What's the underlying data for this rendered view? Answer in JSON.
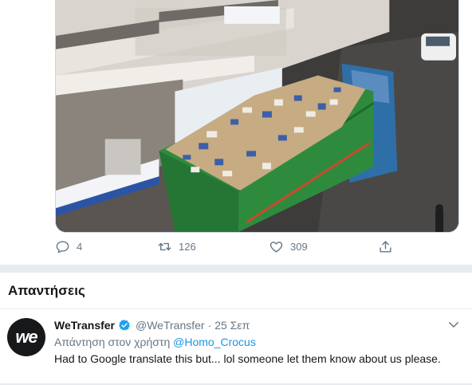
{
  "tweet": {
    "actions": {
      "reply_count": "4",
      "retweet_count": "126",
      "like_count": "309"
    }
  },
  "replies_section": {
    "heading": "Απαντήσεις"
  },
  "reply": {
    "avatar_text": "we",
    "display_name": "WeTransfer",
    "handle": "@WeTransfer",
    "separator": "·",
    "date": "25 Σεπ",
    "reply_to_prefix": "Απάντηση στον χρήστη",
    "reply_to_mention": "@Homo_Crocus",
    "text": "Had to Google translate this but... lol someone let them know about us please."
  },
  "colors": {
    "accent": "#1da1f2",
    "muted": "#657786",
    "divider": "#e6ecf0",
    "truck_green": "#2e8b3e",
    "truck_blue": "#2f6fa8"
  }
}
